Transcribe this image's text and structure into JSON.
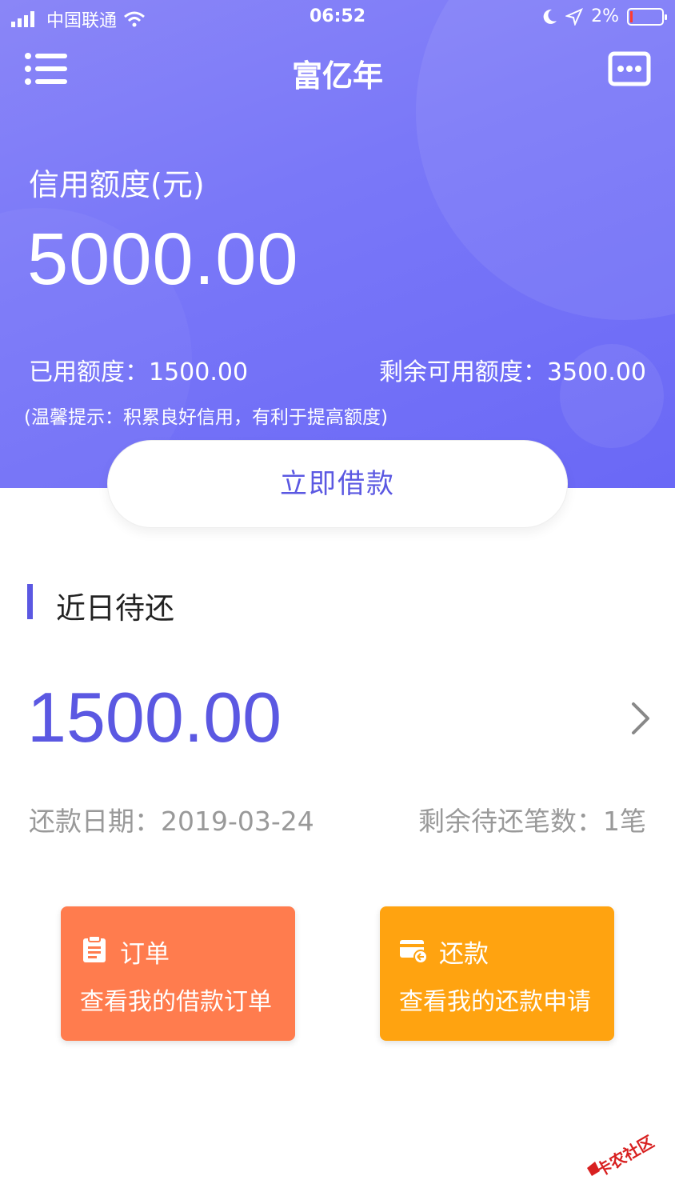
{
  "status_bar": {
    "carrier": "中国联通",
    "time": "06:52",
    "battery": "2%"
  },
  "nav": {
    "title": "富亿年"
  },
  "credit": {
    "label": "信用额度(元)",
    "amount": "5000.00",
    "used": "已用额度：1500.00",
    "remaining": "剩余可用额度：3500.00",
    "tip": "(温馨提示：积累良好信用，有利于提高额度)"
  },
  "borrow_button": "立即借款",
  "upcoming": {
    "title": "近日待还",
    "amount": "1500.00",
    "due_date": "还款日期：2019-03-24",
    "remaining_count": "剩余待还笔数：1笔"
  },
  "cards": {
    "orders": {
      "title": "订单",
      "desc": "查看我的借款订单",
      "icon": "clipboard-icon"
    },
    "repay": {
      "title": "还款",
      "desc": "查看我的还款申请",
      "icon": "card-refund-icon"
    }
  },
  "watermark": "卡农社区",
  "colors": {
    "accent": "#5b58e2",
    "orders_card": "#ff7c4e",
    "repay_card": "#ffa310"
  }
}
